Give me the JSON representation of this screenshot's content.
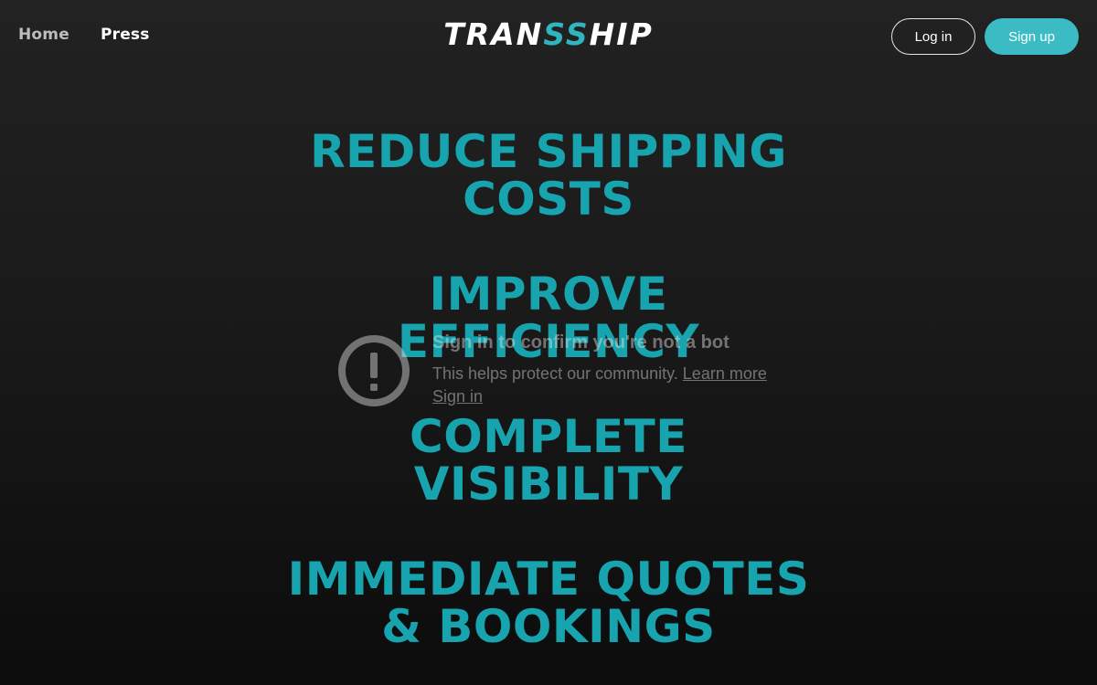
{
  "header": {
    "nav": {
      "home": "Home",
      "press": "Press"
    },
    "logo": {
      "part1": "TRAN",
      "part2": "SS",
      "part3": "HIP"
    },
    "login_label": "Log in",
    "signup_label": "Sign up"
  },
  "hero": {
    "headline1": [
      "REDUCE SHIPPING",
      "COSTS"
    ],
    "headline2": [
      "IMPROVE",
      "EFFICIENCY"
    ],
    "headline3": [
      "COMPLETE",
      "VISIBILITY"
    ],
    "headline4": [
      "IMMEDIATE QUOTES",
      "& BOOKINGS"
    ]
  },
  "notice": {
    "icon": "exclamation-circle-icon",
    "title": "Sign in to confirm you're not a bot",
    "body": "This helps protect our community.",
    "learn_more": "Learn more",
    "sign_in": "Sign in"
  },
  "colors": {
    "accent": "#17a4ae",
    "button": "#3bbcc4",
    "background_top": "#222222",
    "background_bottom": "#0c0c0c"
  }
}
